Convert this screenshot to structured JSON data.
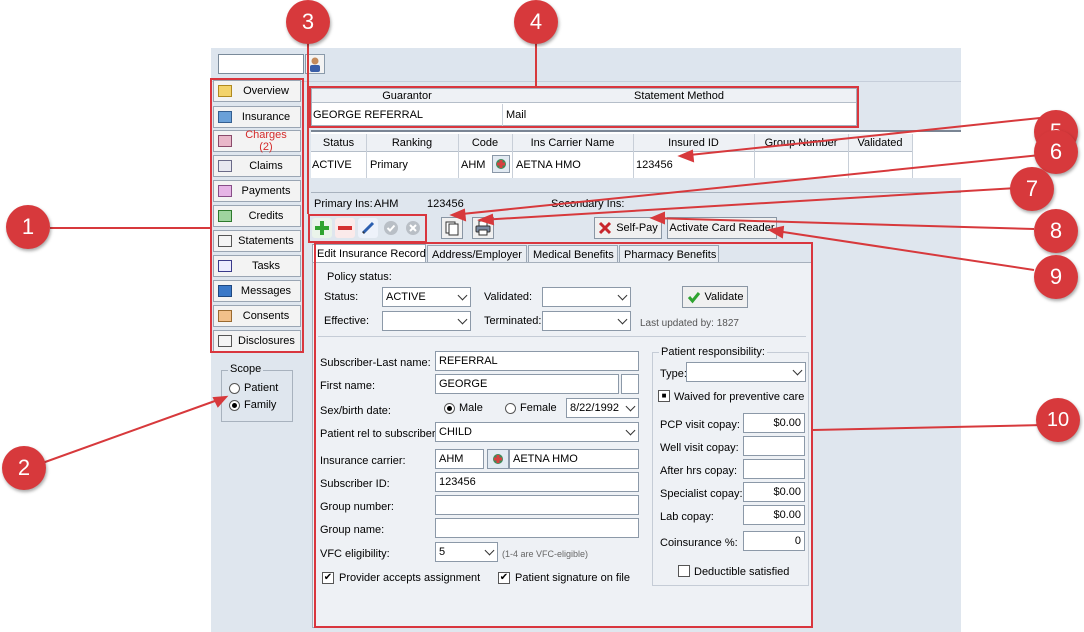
{
  "sidebar": {
    "items": [
      {
        "label": "Overview"
      },
      {
        "label": "Insurance"
      },
      {
        "label": "Charges (2)",
        "color": "#d42b2b"
      },
      {
        "label": "Claims"
      },
      {
        "label": "Payments"
      },
      {
        "label": "Credits"
      },
      {
        "label": "Statements"
      },
      {
        "label": "Tasks"
      },
      {
        "label": "Messages"
      },
      {
        "label": "Consents"
      },
      {
        "label": "Disclosures"
      }
    ],
    "scope": {
      "title": "Scope",
      "options": [
        "Patient",
        "Family"
      ],
      "selected": "Family"
    }
  },
  "guarantor_grid": {
    "headers": [
      "Guarantor",
      "Statement Method"
    ],
    "row": [
      "GEORGE REFERRAL",
      "Mail"
    ]
  },
  "insurance_grid": {
    "headers": [
      "Status",
      "Ranking",
      "Code",
      "Ins Carrier Name",
      "Insured ID",
      "Group Number",
      "Validated"
    ],
    "row": [
      "ACTIVE",
      "Primary",
      "AHM",
      "AETNA HMO",
      "123456",
      "",
      ""
    ]
  },
  "summary": {
    "primary_label": "Primary Ins:",
    "primary_code": "AHM",
    "primary_id": "123456",
    "secondary_label": "Secondary Ins:"
  },
  "toolbar": {
    "self_pay": "Self-Pay",
    "card_reader": "Activate Card Reader"
  },
  "tabs": [
    "Edit Insurance Record",
    "Address/Employer",
    "Medical Benefits",
    "Pharmacy Benefits"
  ],
  "policy": {
    "section": "Policy status:",
    "status_label": "Status:",
    "status_value": "ACTIVE",
    "validated_label": "Validated:",
    "validated_value": "",
    "effective_label": "Effective:",
    "effective_value": "",
    "terminated_label": "Terminated:",
    "terminated_value": "",
    "validate_button": "Validate",
    "last_updated": "Last updated by:  1827"
  },
  "subscriber": {
    "last_name_label": "Subscriber-Last name:",
    "last_name": "REFERRAL",
    "first_name_label": "First name:",
    "first_name": "GEORGE",
    "sex_label": "Sex/birth date:",
    "male": "Male",
    "female": "Female",
    "sex": "Male",
    "birth_date": "8/22/1992",
    "rel_label": "Patient rel to subscriber",
    "rel": "CHILD",
    "carrier_label": "Insurance carrier:",
    "carrier_code": "AHM",
    "carrier_name": "AETNA HMO",
    "id_label": "Subscriber ID:",
    "id": "123456",
    "group_number_label": "Group number:",
    "group_number": "",
    "group_name_label": "Group name:",
    "group_name": "",
    "vfc_label": "VFC eligibility:",
    "vfc": "5",
    "vfc_hint": "(1-4 are VFC-eligible)",
    "accepts_assignment": "Provider accepts assignment",
    "signature_on_file": "Patient signature on file"
  },
  "responsibility": {
    "title": "Patient responsibility:",
    "type_label": "Type:",
    "type_value": "",
    "waived": "Waived for preventive care",
    "pcp_label": "PCP visit copay:",
    "pcp": "$0.00",
    "well_label": "Well visit copay:",
    "well": "",
    "after_label": "After hrs copay:",
    "after": "",
    "specialist_label": "Specialist copay:",
    "specialist": "$0.00",
    "lab_label": "Lab copay:",
    "lab": "$0.00",
    "coins_label": "Coinsurance %:",
    "coins": "0",
    "deductible": "Deductible satisfied"
  },
  "callouts": [
    "1",
    "2",
    "3",
    "4",
    "5",
    "6",
    "7",
    "8",
    "9",
    "10"
  ],
  "colors": {
    "callout": "#d7393c",
    "panel": "#dfe6ee"
  }
}
